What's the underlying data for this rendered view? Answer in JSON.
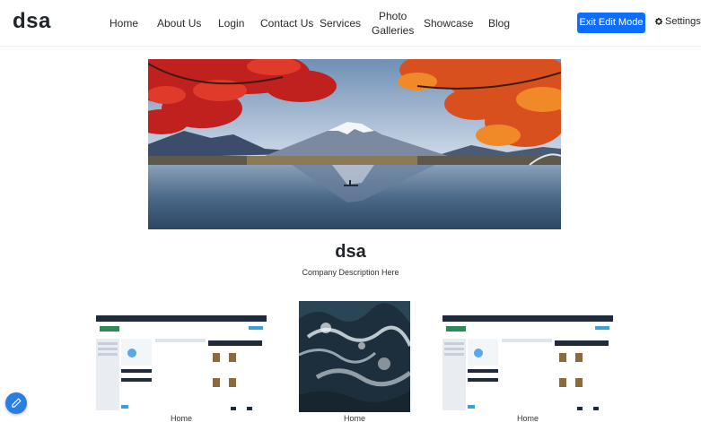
{
  "brand": "dsa",
  "nav": {
    "home": "Home",
    "about": "About Us",
    "login": "Login",
    "contact": "Contact Us",
    "services": "Services",
    "photo_line1": "Photo",
    "photo_line2": "Galleries",
    "showcase": "Showcase",
    "blog": "Blog"
  },
  "toolbar": {
    "exit_edit_label": "Exit Edit Mode",
    "settings_label": "Settings"
  },
  "hero": {
    "icon": "landscape-mountain-lake-image"
  },
  "company": {
    "title": "dsa",
    "description": "Company Description Here"
  },
  "gallery": {
    "items": [
      {
        "caption": "Home",
        "image": "dashboard-screenshot"
      },
      {
        "caption": "Home",
        "image": "ocean-waves-aerial"
      },
      {
        "caption": "Home",
        "image": "dashboard-screenshot"
      }
    ]
  },
  "colors": {
    "primary": "#0d6efd",
    "fab": "#2a7de1"
  }
}
